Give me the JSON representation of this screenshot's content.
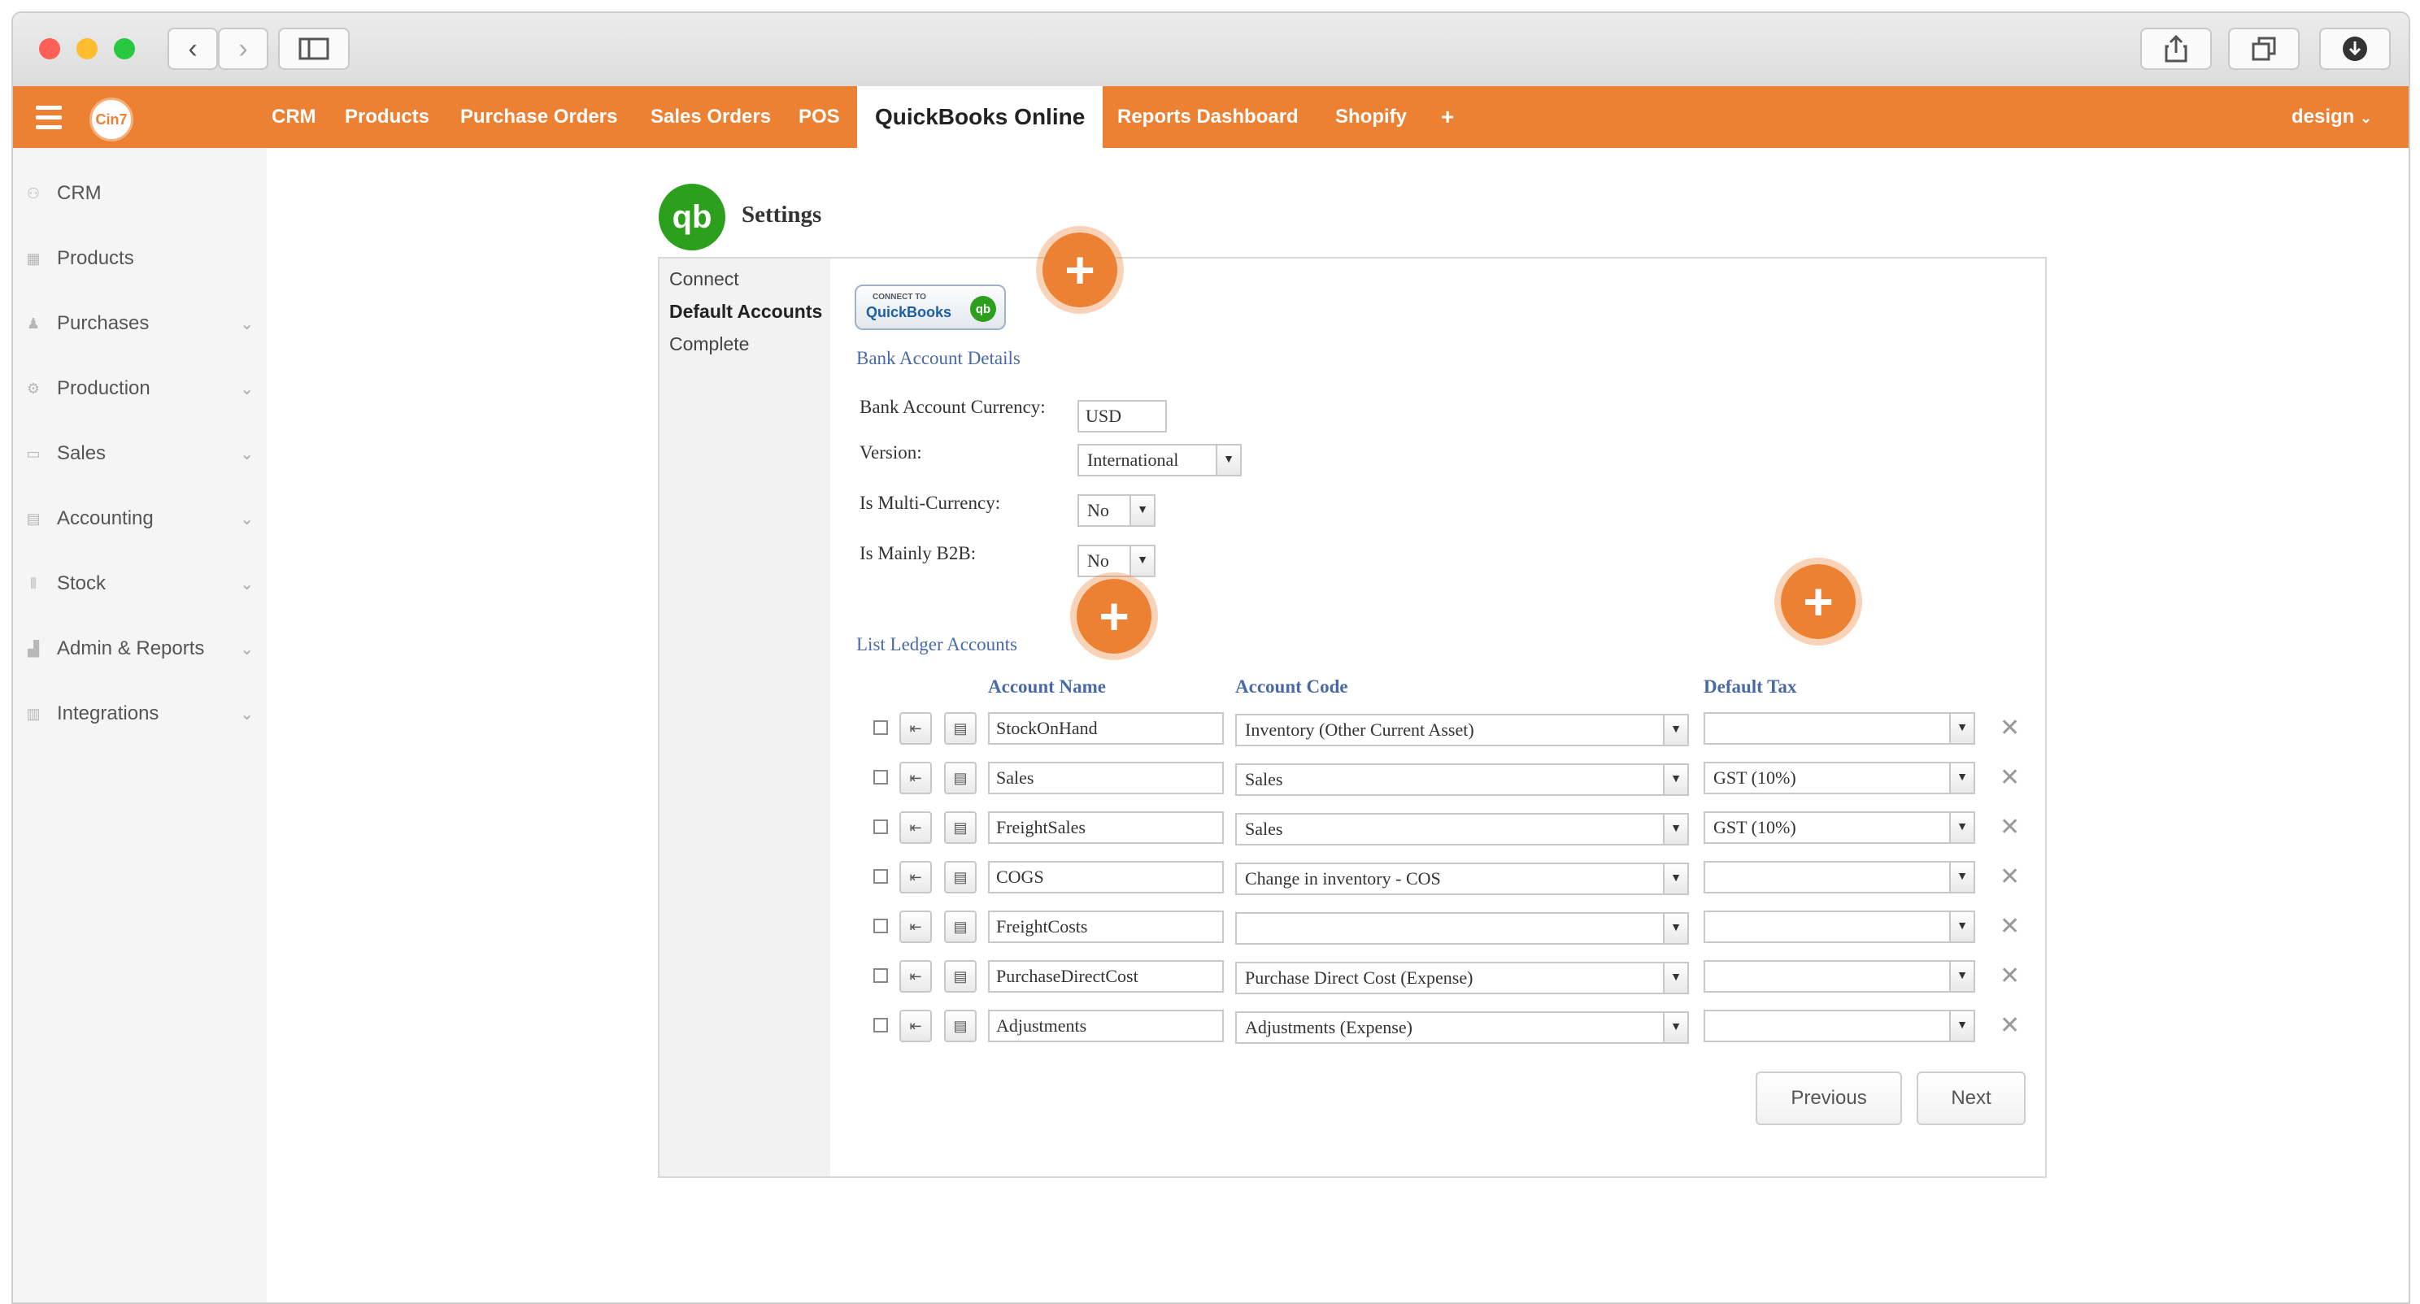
{
  "topnav": {
    "brand_logo": "Cin7",
    "items": [
      "CRM",
      "Products",
      "Purchase Orders",
      "Sales Orders",
      "POS",
      "QuickBooks Online",
      "Reports Dashboard",
      "Shopify",
      "+"
    ],
    "user_menu": "design"
  },
  "sidebar": {
    "items": [
      {
        "label": "CRM",
        "icon": "users-icon",
        "has_children": false
      },
      {
        "label": "Products",
        "icon": "grid-icon",
        "has_children": false
      },
      {
        "label": "Purchases",
        "icon": "person-icon",
        "has_children": true
      },
      {
        "label": "Production",
        "icon": "gears-icon",
        "has_children": true
      },
      {
        "label": "Sales",
        "icon": "card-icon",
        "has_children": true
      },
      {
        "label": "Accounting",
        "icon": "ledger-icon",
        "has_children": true
      },
      {
        "label": "Stock",
        "icon": "barcode-icon",
        "has_children": true
      },
      {
        "label": "Admin & Reports",
        "icon": "chart-icon",
        "has_children": true
      },
      {
        "label": "Integrations",
        "icon": "plug-icon",
        "has_children": true
      }
    ]
  },
  "settings": {
    "logo_text": "qb",
    "title": "Settings",
    "steps": [
      {
        "label": "Connect",
        "active": false
      },
      {
        "label": "Default Accounts",
        "active": true
      },
      {
        "label": "Complete",
        "active": false
      }
    ],
    "connect_button": {
      "line1": "CONNECT TO",
      "line2": "QuickBooks",
      "badge": "qb"
    },
    "bank_section_title": "Bank Account Details",
    "bank_fields": {
      "currency_label": "Bank Account Currency:",
      "currency_value": "USD",
      "version_label": "Version:",
      "version_value": "International",
      "multi_currency_label": "Is Multi-Currency:",
      "multi_currency_value": "No",
      "b2b_label": "Is Mainly B2B:",
      "b2b_value": "No"
    },
    "ledger_section_title": "List Ledger Accounts",
    "ledger_headers": {
      "name": "Account Name",
      "code": "Account Code",
      "tax": "Default Tax"
    },
    "ledger_rows": [
      {
        "name": "StockOnHand",
        "code": "Inventory (Other Current Asset)",
        "tax": ""
      },
      {
        "name": "Sales",
        "code": "Sales",
        "tax": "GST (10%)"
      },
      {
        "name": "FreightSales",
        "code": "Sales",
        "tax": "GST (10%)"
      },
      {
        "name": "COGS",
        "code": "Change in inventory - COS",
        "tax": ""
      },
      {
        "name": "FreightCosts",
        "code": "",
        "tax": ""
      },
      {
        "name": "PurchaseDirectCost",
        "code": "Purchase Direct Cost (Expense)",
        "tax": ""
      },
      {
        "name": "Adjustments",
        "code": "Adjustments (Expense)",
        "tax": ""
      }
    ],
    "previous_label": "Previous",
    "next_label": "Next",
    "plus_symbol": "+"
  }
}
